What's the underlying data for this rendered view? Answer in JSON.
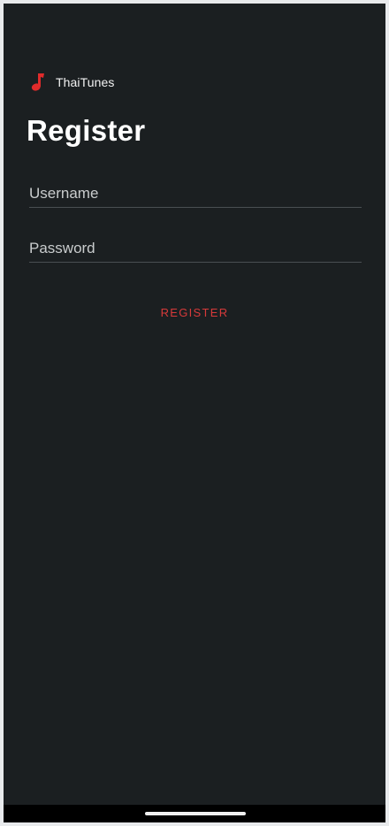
{
  "app": {
    "name": "ThaiTunes",
    "icon": "music-note-icon",
    "accent_color": "#e02b2b"
  },
  "page": {
    "title": "Register"
  },
  "form": {
    "username": {
      "value": "",
      "placeholder": "Username"
    },
    "password": {
      "value": "",
      "placeholder": "Password"
    },
    "register_label": "REGISTER"
  },
  "system": {
    "nav_bar": "home-indicator"
  }
}
